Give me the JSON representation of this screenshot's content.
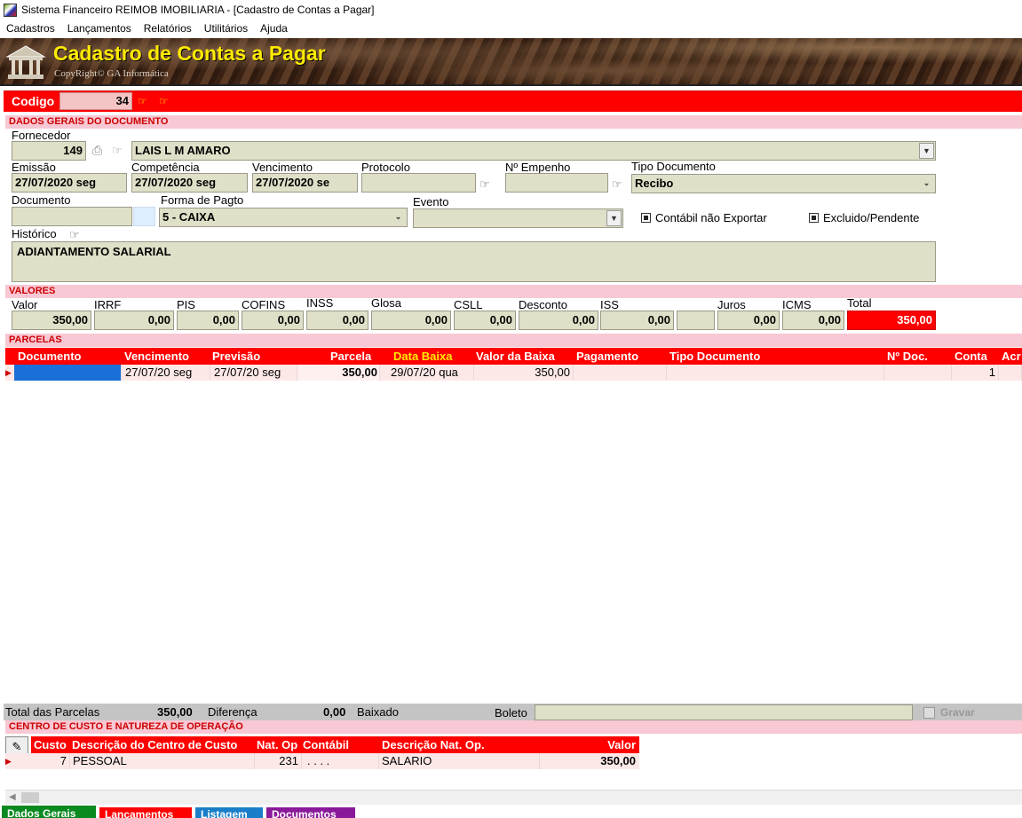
{
  "window": {
    "title": "Sistema Financeiro REIMOB IMOBILIARIA - [Cadastro de Contas a Pagar]"
  },
  "menu": [
    "Cadastros",
    "Lançamentos",
    "Relatórios",
    "Utilitários",
    "Ajuda"
  ],
  "banner": {
    "title": "Cadastro de Contas a Pagar",
    "copyright": "CopyRight© GA Informática"
  },
  "codigo": {
    "label": "Codigo",
    "value": "34"
  },
  "sections": {
    "dados_gerais": "DADOS GERAIS DO DOCUMENTO",
    "valores": "VALORES",
    "parcelas": "PARCELAS",
    "centro_custo": "CENTRO DE CUSTO E NATUREZA DE OPERAÇÃO"
  },
  "fornecedor": {
    "label": "Fornecedor",
    "code": "149",
    "name": "LAIS L M AMARO"
  },
  "emissao": {
    "label": "Emissão",
    "value": "27/07/2020  seg"
  },
  "competencia": {
    "label": "Competência",
    "value": "27/07/2020  seg"
  },
  "vencimento": {
    "label": "Vencimento",
    "value": "27/07/2020  se"
  },
  "protocolo": {
    "label": "Protocolo",
    "value": ""
  },
  "empenho": {
    "label": "Nº Empenho",
    "value": ""
  },
  "tipo_documento": {
    "label": "Tipo Documento",
    "value": "Recibo"
  },
  "documento": {
    "label": "Documento",
    "value": ""
  },
  "forma_pagto": {
    "label": "Forma de Pagto",
    "value": "5 - CAIXA"
  },
  "evento": {
    "label": "Evento",
    "value": ""
  },
  "contabil_nao_exportar": {
    "label": "Contábil não Exportar"
  },
  "excluido_pendente": {
    "label": "Excluido/Pendente"
  },
  "historico": {
    "label": "Histórico",
    "value": "ADIANTAMENTO SALARIAL"
  },
  "valores": {
    "valor": {
      "label": "Valor",
      "value": "350,00"
    },
    "irrf": {
      "label": "IRRF",
      "value": "0,00"
    },
    "pis": {
      "label": "PIS",
      "value": "0,00"
    },
    "cofins": {
      "label": "COFINS",
      "value": "0,00"
    },
    "inss": {
      "label": "INSS",
      "value": "0,00"
    },
    "glosa": {
      "label": "Glosa",
      "value": "0,00"
    },
    "csll": {
      "label": "CSLL",
      "value": "0,00"
    },
    "desconto": {
      "label": "Desconto",
      "value": "0,00"
    },
    "iss": {
      "label": "ISS",
      "value": "0,00"
    },
    "blank": {
      "value": ""
    },
    "juros": {
      "label": "Juros",
      "value": "0,00"
    },
    "icms": {
      "label": "ICMS",
      "value": "0,00"
    },
    "total": {
      "label": "Total",
      "value": "350,00"
    }
  },
  "parcelas_grid": {
    "columns": [
      "Documento",
      "Vencimento",
      "Previsão",
      "Parcela",
      "Data Baixa",
      "Valor da Baixa",
      "Pagamento",
      "Tipo Documento",
      "Nº Doc.",
      "Conta",
      "Acr"
    ],
    "rows": [
      {
        "documento": "",
        "vencimento": "27/07/20  seg",
        "previsao": "27/07/20  seg",
        "parcela": "350,00",
        "data_baixa": "29/07/20  qua",
        "valor_baixa": "350,00",
        "pagamento": "",
        "tipo_documento": "",
        "num_doc": "",
        "conta": "1",
        "acr": ""
      }
    ]
  },
  "totais": {
    "total_parcelas_label": "Total das Parcelas",
    "total_parcelas": "350,00",
    "diferenca_label": "Diferença",
    "diferenca": "0,00",
    "baixado_label": "Baixado",
    "boleto_label": "Boleto",
    "boleto": "",
    "gravar_label": "Gravar"
  },
  "cc_grid": {
    "columns": [
      "Custo",
      "Descrição do Centro de Custo",
      "Nat. Op",
      "Contábil",
      "Descrição Nat. Op.",
      "Valor"
    ],
    "rows": [
      {
        "custo": "7",
        "descricao": "PESSOAL",
        "nat_op": "231",
        "contabil": ". . . .",
        "descricao_nat": "SALARIO",
        "valor": "350,00"
      }
    ]
  },
  "tabs": [
    "Dados Gerais",
    "Lançamentos",
    "Listagem",
    "Documentos"
  ],
  "colors": {
    "accent": "#ff0000",
    "section_bg": "#f8c8d4",
    "field_bg": "#e0e0c8",
    "yellow": "#ffea00"
  }
}
